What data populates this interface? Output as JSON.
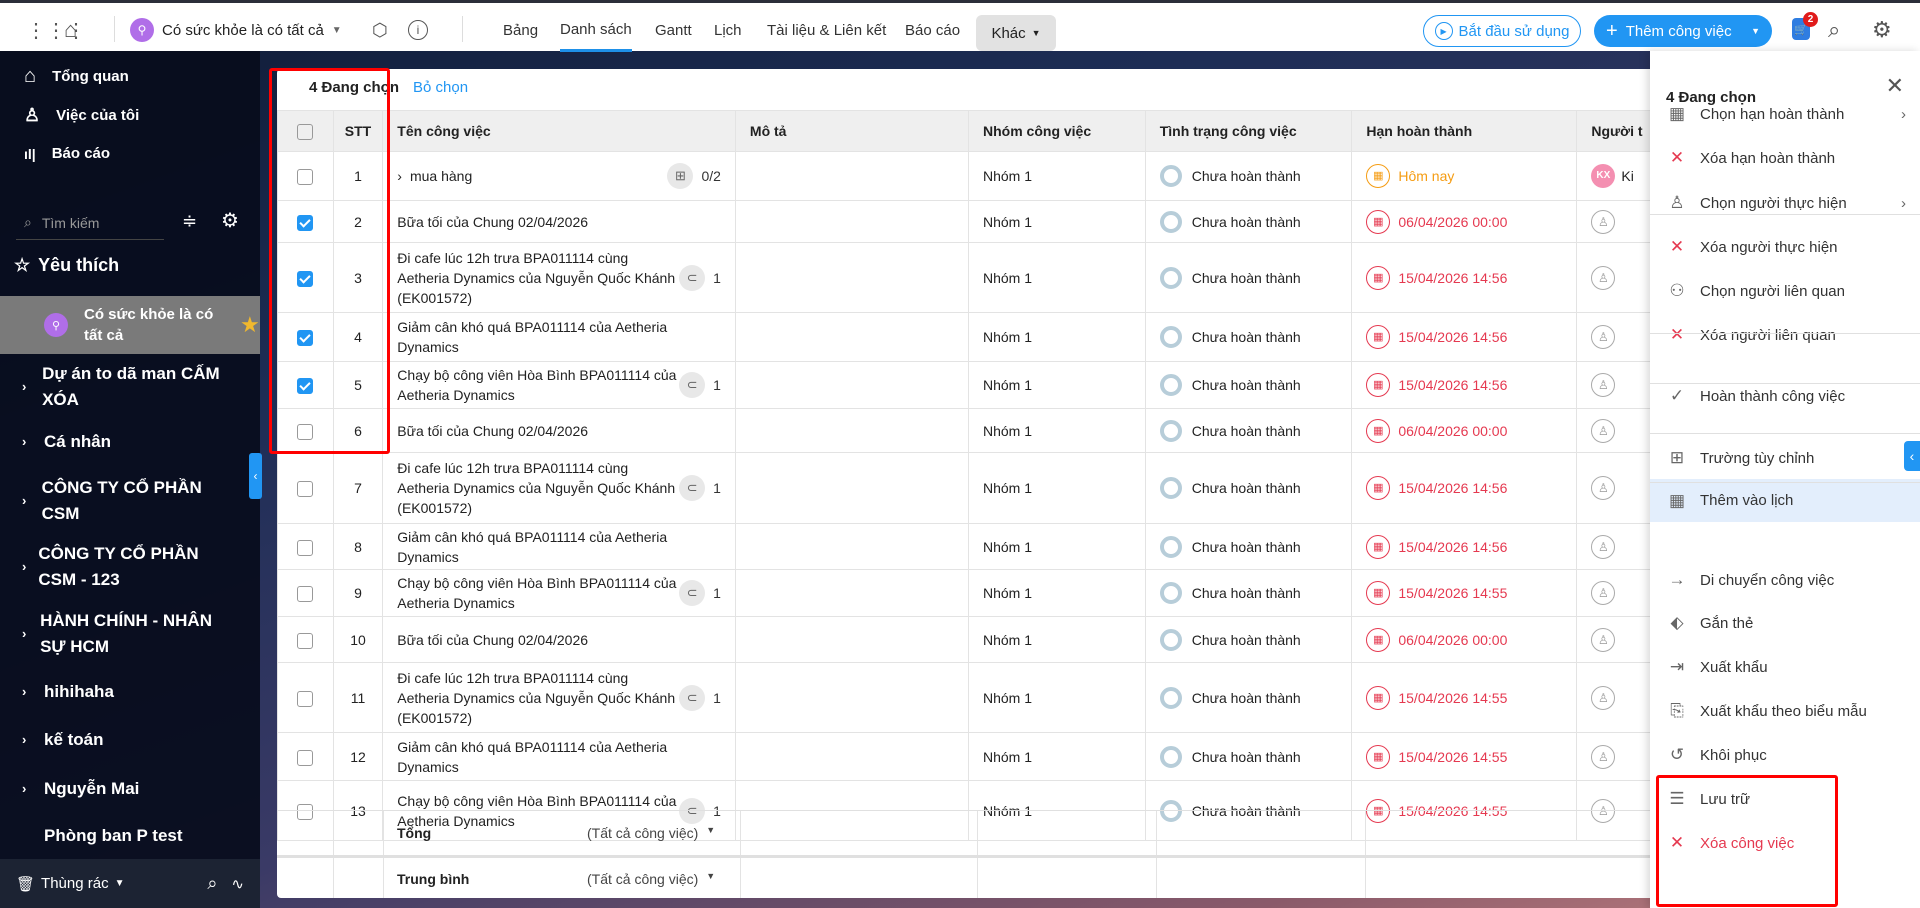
{
  "topbar": {
    "project_name": "Có sức khỏe là có tất cả",
    "tabs": [
      "Bảng",
      "Danh sách",
      "Gantt",
      "Lịch",
      "Tài liệu & Liên kết",
      "Báo cáo"
    ],
    "more_label": "Khác",
    "start_label": "Bắt đầu sử dụng",
    "add_task_label": "Thêm công việc",
    "cart_count": "2"
  },
  "sidebar": {
    "nav": [
      "Tổng quan",
      "Việc của tôi",
      "Báo cáo"
    ],
    "search_placeholder": "Tìm kiếm",
    "favorites_label": "Yêu thích",
    "favorite_item": "Có sức khỏe là có tất cả",
    "tree": [
      "Dự án to dã man CẤM XÓA",
      "Cá nhân",
      "CÔNG TY CỔ PHẦN CSM",
      "CÔNG TY CỔ PHẦN CSM - 123",
      "HÀNH CHÍNH - NHÂN SỰ HCM",
      "hihihaha",
      "kế toán",
      "Nguyễn Mai",
      "Phòng ban P test"
    ],
    "trash_label": "Thùng rác"
  },
  "selection": {
    "count_label": "4 Đang chọn",
    "deselect_label": "Bỏ chọn"
  },
  "table": {
    "headers": [
      "STT",
      "Tên công việc",
      "Mô tả",
      "Nhóm công việc",
      "Tình trạng công việc",
      "Hạn hoàn thành",
      "Người t"
    ],
    "rows": [
      {
        "stt": "1",
        "name": "mua hàng",
        "expand": true,
        "subtasks": "0/2",
        "group": "Nhóm 1",
        "status": "Chưa hoàn thành",
        "due": "Hôm nay",
        "today": true,
        "checked": false,
        "assignee_initials": "KX",
        "assignee_name": "Ki Đ"
      },
      {
        "stt": "2",
        "name": "Bữa tối của Chung 02/04/2026",
        "group": "Nhóm 1",
        "status": "Chưa hoàn thành",
        "due": "06/04/2026 00:00",
        "checked": true
      },
      {
        "stt": "3",
        "name": "Đi cafe lúc 12h trưa BPA011114 cùng Aetheria Dynamics của Nguyễn Quốc Khánh (EK001572)",
        "attach": "1",
        "group": "Nhóm 1",
        "status": "Chưa hoàn thành",
        "due": "15/04/2026 14:56",
        "checked": true
      },
      {
        "stt": "4",
        "name": "Giảm cân khó quá BPA011114 của Aetheria Dynamics",
        "group": "Nhóm 1",
        "status": "Chưa hoàn thành",
        "due": "15/04/2026 14:56",
        "checked": true
      },
      {
        "stt": "5",
        "name": "Chạy bộ công viên Hòa Bình BPA011114 của Aetheria Dynamics",
        "attach": "1",
        "group": "Nhóm 1",
        "status": "Chưa hoàn thành",
        "due": "15/04/2026 14:56",
        "checked": true
      },
      {
        "stt": "6",
        "name": "Bữa tối của Chung 02/04/2026",
        "group": "Nhóm 1",
        "status": "Chưa hoàn thành",
        "due": "06/04/2026 00:00",
        "checked": false
      },
      {
        "stt": "7",
        "name": "Đi cafe lúc 12h trưa BPA011114 cùng Aetheria Dynamics của Nguyễn Quốc Khánh (EK001572)",
        "attach": "1",
        "group": "Nhóm 1",
        "status": "Chưa hoàn thành",
        "due": "15/04/2026 14:56",
        "checked": false
      },
      {
        "stt": "8",
        "name": "Giảm cân khó quá BPA011114 của Aetheria Dynamics",
        "group": "Nhóm 1",
        "status": "Chưa hoàn thành",
        "due": "15/04/2026 14:56",
        "checked": false
      },
      {
        "stt": "9",
        "name": "Chạy bộ công viên Hòa Bình BPA011114 của Aetheria Dynamics",
        "attach": "1",
        "group": "Nhóm 1",
        "status": "Chưa hoàn thành",
        "due": "15/04/2026 14:55",
        "checked": false
      },
      {
        "stt": "10",
        "name": "Bữa tối của Chung 02/04/2026",
        "group": "Nhóm 1",
        "status": "Chưa hoàn thành",
        "due": "06/04/2026 00:00",
        "checked": false
      },
      {
        "stt": "11",
        "name": "Đi cafe lúc 12h trưa BPA011114 cùng Aetheria Dynamics của Nguyễn Quốc Khánh (EK001572)",
        "attach": "1",
        "group": "Nhóm 1",
        "status": "Chưa hoàn thành",
        "due": "15/04/2026 14:55",
        "checked": false
      },
      {
        "stt": "12",
        "name": "Giảm cân khó quá BPA011114 của Aetheria Dynamics",
        "group": "Nhóm 1",
        "status": "Chưa hoàn thành",
        "due": "15/04/2026 14:55",
        "checked": false
      },
      {
        "stt": "13",
        "name": "Chạy bộ công viên Hòa Bình BPA011114 của Aetheria Dynamics",
        "attach": "1",
        "group": "Nhóm 1",
        "status": "Chưa hoàn thành",
        "due": "15/04/2026 14:55",
        "checked": false
      }
    ],
    "footer": [
      {
        "label": "Tổng",
        "scope": "(Tất cả công việc)"
      },
      {
        "label": "Trung bình",
        "scope": "(Tất cả công việc)"
      }
    ]
  },
  "panel": {
    "title": "4 Đang chọn",
    "items": [
      "Chọn hạn hoàn thành",
      "Xóa hạn hoàn thành",
      "Chọn người thực hiện",
      "Xóa người thực hiện",
      "Chọn người liên quan",
      "Xóa người liên quan",
      "Hoàn thành công việc",
      "Trường tùy chỉnh",
      "Thêm vào lịch",
      "Di chuyển công việc",
      "Gắn thẻ",
      "Xuất khẩu",
      "Xuất khẩu theo biểu mẫu",
      "Khôi phục",
      "Lưu trữ",
      "Xóa công việc"
    ]
  },
  "colors": {
    "accent": "#2196f3",
    "overdue": "#e53950",
    "today": "#f59c12",
    "highlight": "#e3eefc"
  }
}
